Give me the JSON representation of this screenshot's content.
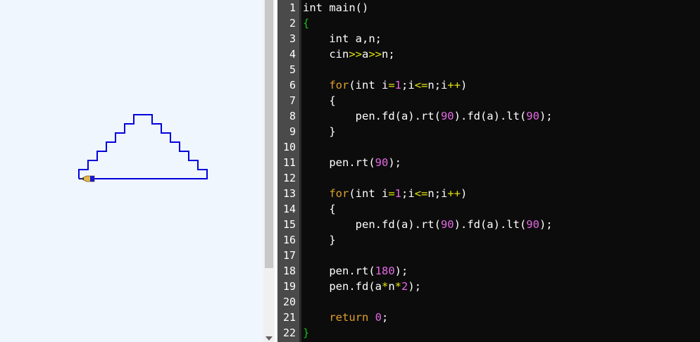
{
  "line_numbers": [
    "1",
    "2",
    "3",
    "4",
    "5",
    "6",
    "7",
    "8",
    "9",
    "10",
    "11",
    "12",
    "13",
    "14",
    "15",
    "16",
    "17",
    "18",
    "19",
    "20",
    "21",
    "22"
  ],
  "code_lines": [
    [
      {
        "t": "int main()",
        "c": "id"
      }
    ],
    [
      {
        "t": "{",
        "c": "br"
      }
    ],
    [
      {
        "t": "    int a,n;",
        "c": "id"
      }
    ],
    [
      {
        "t": "    cin",
        "c": "id"
      },
      {
        "t": ">>",
        "c": "op"
      },
      {
        "t": "a",
        "c": "id"
      },
      {
        "t": ">>",
        "c": "op"
      },
      {
        "t": "n;",
        "c": "id"
      }
    ],
    [],
    [
      {
        "t": "    ",
        "c": "id"
      },
      {
        "t": "for",
        "c": "kw"
      },
      {
        "t": "(int i",
        "c": "id"
      },
      {
        "t": "=",
        "c": "op"
      },
      {
        "t": "1",
        "c": "num"
      },
      {
        "t": ";i",
        "c": "id"
      },
      {
        "t": "<=",
        "c": "op"
      },
      {
        "t": "n;i",
        "c": "id"
      },
      {
        "t": "++",
        "c": "op"
      },
      {
        "t": ")",
        "c": "id"
      }
    ],
    [
      {
        "t": "    {",
        "c": "id"
      }
    ],
    [
      {
        "t": "        pen.fd(a).rt(",
        "c": "id"
      },
      {
        "t": "90",
        "c": "num"
      },
      {
        "t": ").fd(a).lt(",
        "c": "id"
      },
      {
        "t": "90",
        "c": "num"
      },
      {
        "t": ");",
        "c": "id"
      }
    ],
    [
      {
        "t": "    }",
        "c": "id"
      }
    ],
    [],
    [
      {
        "t": "    pen.rt(",
        "c": "id"
      },
      {
        "t": "90",
        "c": "num"
      },
      {
        "t": ");",
        "c": "id"
      }
    ],
    [],
    [
      {
        "t": "    ",
        "c": "id"
      },
      {
        "t": "for",
        "c": "kw"
      },
      {
        "t": "(int i",
        "c": "id"
      },
      {
        "t": "=",
        "c": "op"
      },
      {
        "t": "1",
        "c": "num"
      },
      {
        "t": ";i",
        "c": "id"
      },
      {
        "t": "<=",
        "c": "op"
      },
      {
        "t": "n;i",
        "c": "id"
      },
      {
        "t": "++",
        "c": "op"
      },
      {
        "t": ")",
        "c": "id"
      }
    ],
    [
      {
        "t": "    {",
        "c": "id"
      }
    ],
    [
      {
        "t": "        pen.fd(a).rt(",
        "c": "id"
      },
      {
        "t": "90",
        "c": "num"
      },
      {
        "t": ").fd(a).lt(",
        "c": "id"
      },
      {
        "t": "90",
        "c": "num"
      },
      {
        "t": ");",
        "c": "id"
      }
    ],
    [
      {
        "t": "    }",
        "c": "id"
      }
    ],
    [],
    [
      {
        "t": "    pen.rt(",
        "c": "id"
      },
      {
        "t": "180",
        "c": "num"
      },
      {
        "t": ");",
        "c": "id"
      }
    ],
    [
      {
        "t": "    pen.fd(a",
        "c": "id"
      },
      {
        "t": "*",
        "c": "op"
      },
      {
        "t": "n",
        "c": "id"
      },
      {
        "t": "*",
        "c": "op"
      },
      {
        "t": "2",
        "c": "num"
      },
      {
        "t": ");",
        "c": "id"
      }
    ],
    [],
    [
      {
        "t": "    ",
        "c": "id"
      },
      {
        "t": "return",
        "c": "kw"
      },
      {
        "t": " ",
        "c": "id"
      },
      {
        "t": "0",
        "c": "num"
      },
      {
        "t": ";",
        "c": "id"
      }
    ],
    [
      {
        "t": "}",
        "c": "br"
      }
    ]
  ],
  "turtle": {
    "steps": 7,
    "stroke_color": "#0000dd",
    "pen_icon": "pencil-icon"
  },
  "colors": {
    "canvas_bg": "#f0f6fe",
    "editor_bg": "#0c0c0c",
    "gutter_bg": "#4a4a4a"
  }
}
